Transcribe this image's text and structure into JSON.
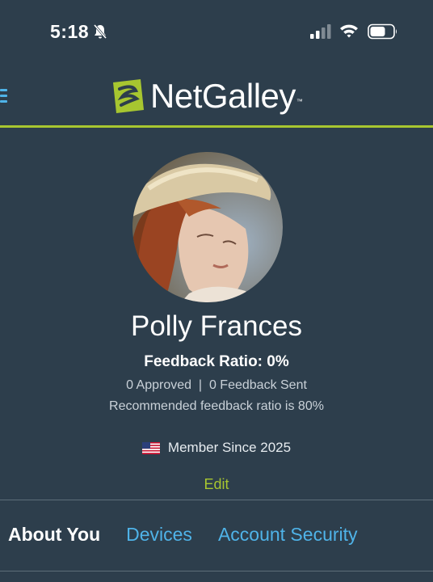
{
  "status_bar": {
    "time": "5:18",
    "icons": [
      "bell-slash-icon",
      "signal-icon",
      "wifi-icon",
      "battery-icon"
    ]
  },
  "header": {
    "logo_text": "NetGalley",
    "logo_tm": "™",
    "menu_icon": "hamburger-menu-icon",
    "accent_color": "#a7c630"
  },
  "profile": {
    "name": "Polly Frances",
    "feedback_ratio": "Feedback Ratio: 0%",
    "approved_line": "0 Approved  |  0 Feedback Sent",
    "recommended_line": "Recommended feedback ratio is 80%",
    "member_since": "Member Since 2025",
    "flag_icon": "us-flag-icon",
    "edit_label": "Edit"
  },
  "tabs": [
    {
      "label": "About You",
      "active": true
    },
    {
      "label": "Devices",
      "active": false
    },
    {
      "label": "Account Security",
      "active": false
    }
  ],
  "colors": {
    "background": "#2d3e4c",
    "link": "#4fb3e8",
    "accent": "#a7c630"
  }
}
